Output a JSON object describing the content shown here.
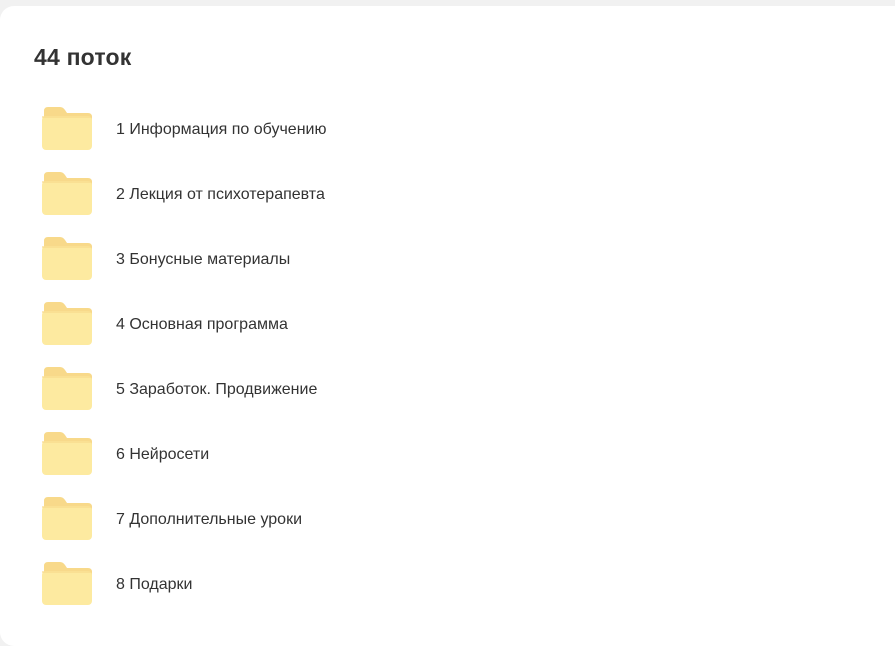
{
  "page": {
    "title": "44 поток"
  },
  "colors": {
    "background": "#f1f1f1",
    "card": "#ffffff",
    "text": "#333333",
    "folder_body": "#fdeaa0",
    "folder_tab": "#f8d98a"
  },
  "folders": [
    {
      "label": "1 Информация по обучению",
      "icon": "folder-icon"
    },
    {
      "label": "2 Лекция от психотерапевта",
      "icon": "folder-icon"
    },
    {
      "label": "3 Бонусные материалы",
      "icon": "folder-icon"
    },
    {
      "label": "4 Основная программа",
      "icon": "folder-icon"
    },
    {
      "label": "5 Заработок. Продвижение",
      "icon": "folder-icon"
    },
    {
      "label": "6 Нейросети",
      "icon": "folder-icon"
    },
    {
      "label": "7 Дополнительные уроки",
      "icon": "folder-icon"
    },
    {
      "label": "8 Подарки",
      "icon": "folder-icon"
    }
  ]
}
